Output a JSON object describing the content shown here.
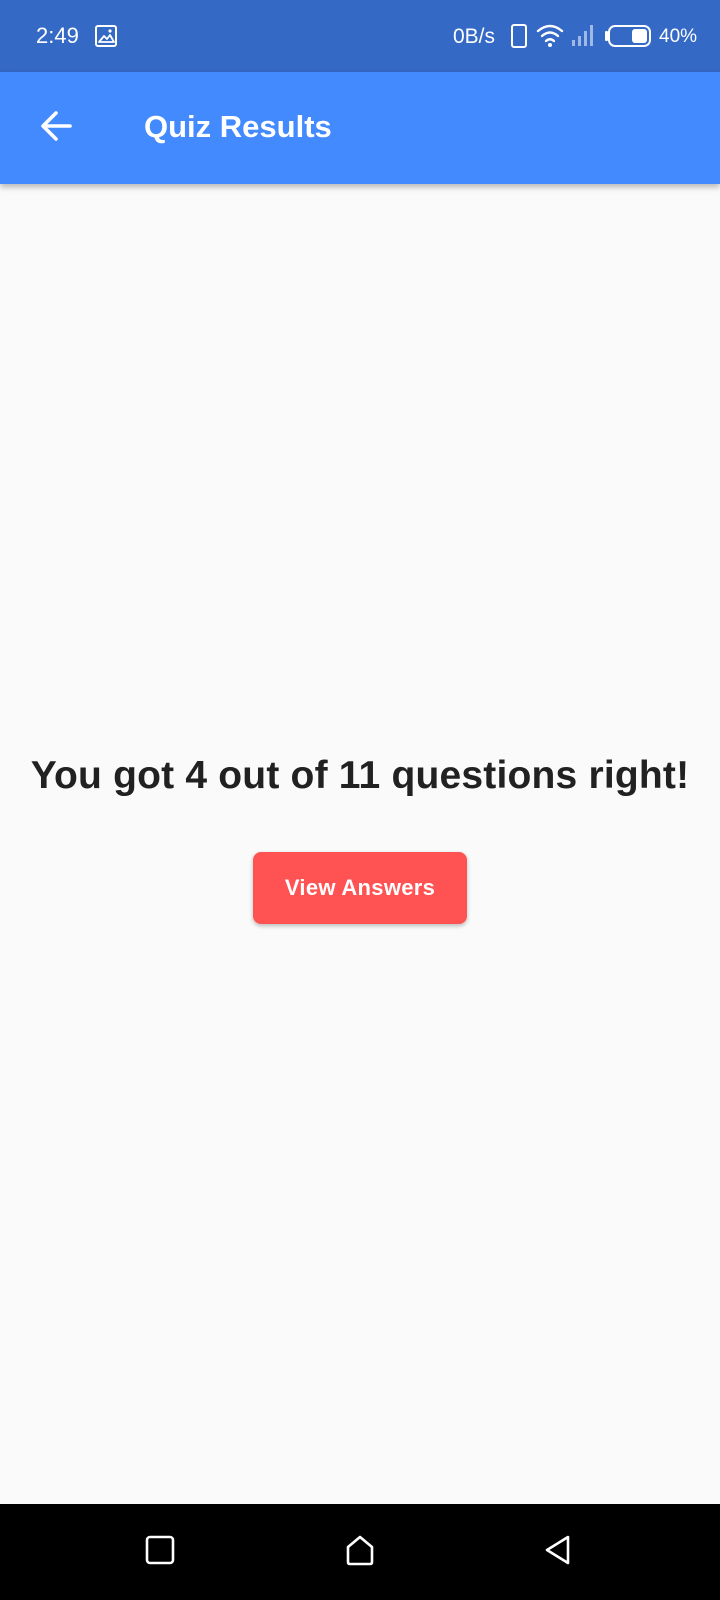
{
  "status_bar": {
    "time": "2:49",
    "network_speed": "0B/s",
    "battery_percent": "40%",
    "battery_level": 0.4,
    "icons": [
      "gallery-icon",
      "vibrate-icon",
      "wifi-icon",
      "signal-icon",
      "battery-icon"
    ],
    "background_color": "#3469c6"
  },
  "app_bar": {
    "title": "Quiz Results",
    "back_icon": "arrow-left-icon",
    "background_color": "#448aff"
  },
  "main": {
    "result_message": "You got 4 out of 11 questions right!",
    "view_answers_label": "View Answers",
    "button_color": "#ff5252"
  },
  "nav_bar": {
    "icons": [
      "recents-square-icon",
      "home-icon",
      "back-triangle-icon"
    ]
  }
}
